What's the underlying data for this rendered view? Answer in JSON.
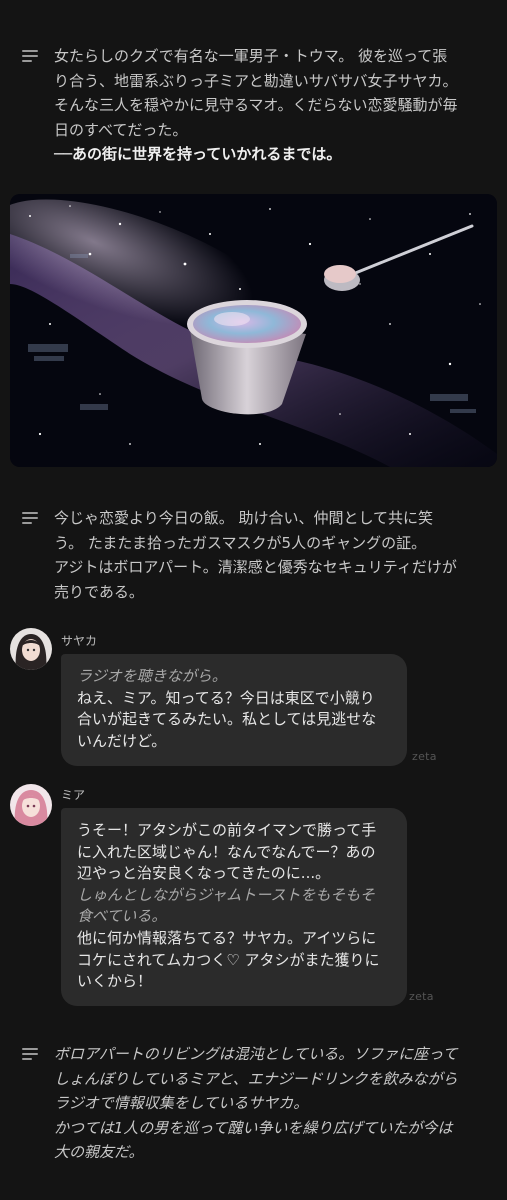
{
  "narration_1": {
    "lines": [
      "女たらしのクズで有名な一軍男子・トウマ。 彼を巡って張",
      "り合う、地雷系ぶりっ子ミアと勘違いサバサバ女子サヤカ。",
      "そんな三人を穏やかに見守るマオ。くだらない恋愛騒動が毎",
      "日のすべてだった。",
      "──あの街に世界を持っていかれるまでは。"
    ]
  },
  "scene_image": {
    "icon": "space-ice-cream-illustration",
    "description_colors": [
      "#05060f",
      "#7a5ba8",
      "#e8d8e8"
    ]
  },
  "narration_2": {
    "lines": [
      "今じゃ恋愛より今日の飯。 助け合い、仲間として共に笑",
      "う。 たまたま拾ったガスマスクが5人のギャングの証。",
      "アジトはボロアパート。清潔感と優秀なセキュリティだけが",
      "売りである。"
    ]
  },
  "messages": [
    {
      "name": "サヤカ",
      "lines": [
        "ラジオを聴きながら。",
        "ねえ、ミア。知ってる？今日は東区で小競り",
        "合いが起きてるみたい。私としては見逃せな",
        "いんだけど。"
      ],
      "footer": "zeta"
    },
    {
      "name": "ミア",
      "lines": [
        "うそー！アタシがこの前タイマンで勝って手",
        "に入れた区域じゃん！なんでなんでー？あの",
        "辺やっと治安良くなってきたのに...。",
        "しゅんとしながらジャムトーストをもそもそ",
        "食べている。",
        "他に何か情報落ちてる？サヤカ。アイツらに",
        "コケにされてムカつく♡ アタシがまた獲りに",
        "いくから！"
      ],
      "footer": "zeta"
    }
  ],
  "narration_3": {
    "lines": [
      "ボロアパートのリビングは混沌としている。ソファに座って",
      "しょんぼりしているミアと、エナジードリンクを飲みながら",
      "ラジオで情報収集をしているサヤカ。",
      "かつては1人の男を巡って醜い争いを繰り広げていたが今は",
      "大の親友だ。"
    ]
  },
  "colors": {
    "background": "#141414",
    "bubble": "#2b2b2b",
    "text": "#d6d6d6",
    "muted": "#a8a8a8"
  }
}
